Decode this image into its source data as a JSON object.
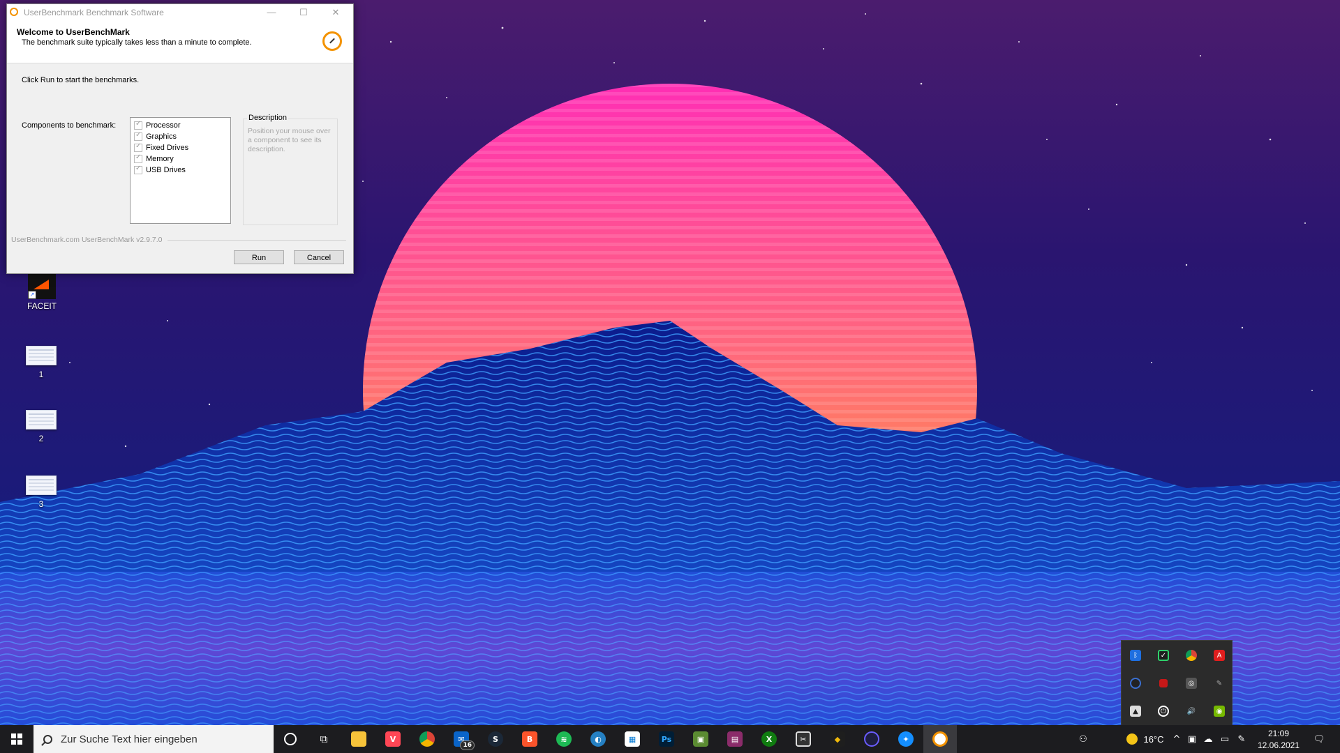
{
  "window": {
    "title": "UserBenchmark Benchmark Software",
    "minimize": "—",
    "maximize": "☐",
    "close": "✕",
    "header_title": "Welcome to UserBenchMark",
    "header_subtitle": "The benchmark suite typically takes less than a minute to complete.",
    "instruction": "Click Run to start the benchmarks.",
    "components_label": "Components to benchmark:",
    "components": [
      {
        "label": "Processor",
        "checked": true
      },
      {
        "label": "Graphics",
        "checked": true
      },
      {
        "label": "Fixed Drives",
        "checked": true
      },
      {
        "label": "Memory",
        "checked": true
      },
      {
        "label": "USB Drives",
        "checked": true
      }
    ],
    "description_title": "Description",
    "description_text": "Position your mouse over a component to see its description.",
    "footer": "UserBenchmark.com UserBenchMark v2.9.7.0",
    "run_label": "Run",
    "cancel_label": "Cancel"
  },
  "desktop": {
    "icons": [
      {
        "label": "FACEIT",
        "icon": "faceit-icon"
      },
      {
        "label": "1",
        "icon": "document-thumbnail"
      },
      {
        "label": "2",
        "icon": "document-thumbnail"
      },
      {
        "label": "3",
        "icon": "document-thumbnail"
      }
    ]
  },
  "taskbar": {
    "search_placeholder": "Zur Suche Text hier eingeben",
    "apps": [
      {
        "name": "cortana-icon"
      },
      {
        "name": "task-view-icon"
      },
      {
        "name": "file-explorer-icon"
      },
      {
        "name": "valorant-icon"
      },
      {
        "name": "chrome-icon"
      },
      {
        "name": "mail-icon",
        "badge": "16"
      },
      {
        "name": "steam-icon"
      },
      {
        "name": "brave-icon"
      },
      {
        "name": "spotify-icon"
      },
      {
        "name": "teamspeak-icon"
      },
      {
        "name": "store-icon"
      },
      {
        "name": "photoshop-icon"
      },
      {
        "name": "minecraft-launcher-icon"
      },
      {
        "name": "winrar-icon"
      },
      {
        "name": "xbox-icon"
      },
      {
        "name": "snipping-tool-icon"
      },
      {
        "name": "binance-icon"
      },
      {
        "name": "lightshot-icon"
      },
      {
        "name": "battlenet-icon"
      },
      {
        "name": "userbenchmark-icon"
      }
    ],
    "weather_temp": "16°C",
    "time": "21:09",
    "date": "12.06.2021"
  },
  "tray_overflow": {
    "icons": [
      "bluetooth-icon",
      "windows-security-icon",
      "chrome-icon",
      "acrobat-icon",
      "obs-icon",
      "red-app-icon",
      "nvidia-shadowplay-icon",
      "pen-icon",
      "network-drive-icon",
      "shield-icon",
      "volume-icon",
      "nvidia-icon"
    ]
  },
  "colors": {
    "accent_orange": "#f39200",
    "taskbar": "#1c1c1f"
  }
}
